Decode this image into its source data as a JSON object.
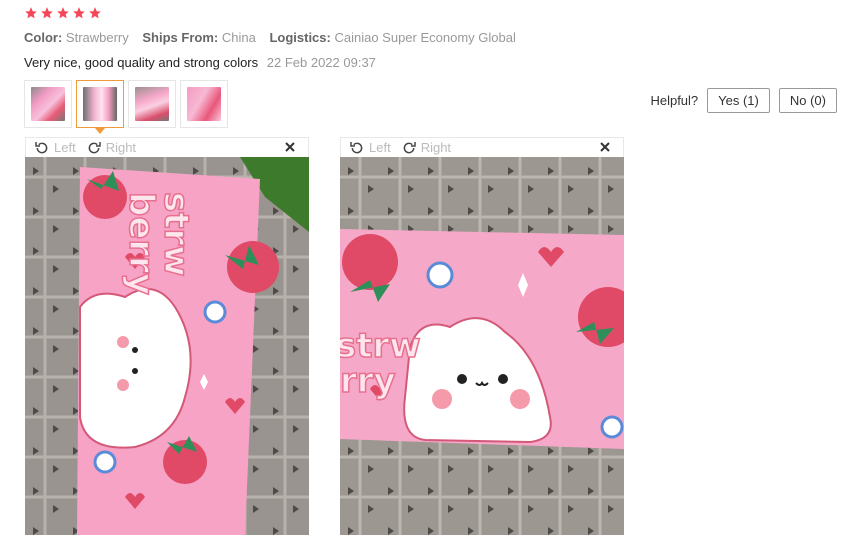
{
  "rating": {
    "stars": 5,
    "icons": [
      "star-icon",
      "star-icon",
      "star-icon",
      "star-icon",
      "star-icon"
    ],
    "color": "#f5475a"
  },
  "meta": {
    "color_label": "Color:",
    "color_value": "Strawberry",
    "ships_label": "Ships From:",
    "ships_value": "China",
    "logistics_label": "Logistics:",
    "logistics_value": "Cainiao Super Economy Global"
  },
  "review": {
    "text": "Very nice, good quality and strong colors",
    "date": "22 Feb 2022 09:37"
  },
  "thumbnails": {
    "count": 4,
    "active_index": 1,
    "active_border_color": "#f29a3a"
  },
  "helpful": {
    "question": "Helpful?",
    "yes_label": "Yes (1)",
    "no_label": "No (0)"
  },
  "viewer": {
    "rotate_left_label": "Left",
    "rotate_right_label": "Right",
    "close_icon": "close-icon",
    "rotate_left_icon": "rotate-left-icon",
    "rotate_right_icon": "rotate-right-icon"
  },
  "photo_text": {
    "viewer1_line1": "strw",
    "viewer1_line2": "berry",
    "viewer2_line1": "strw",
    "viewer2_line2": "rry"
  },
  "colors": {
    "pink": "#f6a6c8",
    "strawberry_red": "#e8566f",
    "leaf_green": "#2f8f5b"
  }
}
